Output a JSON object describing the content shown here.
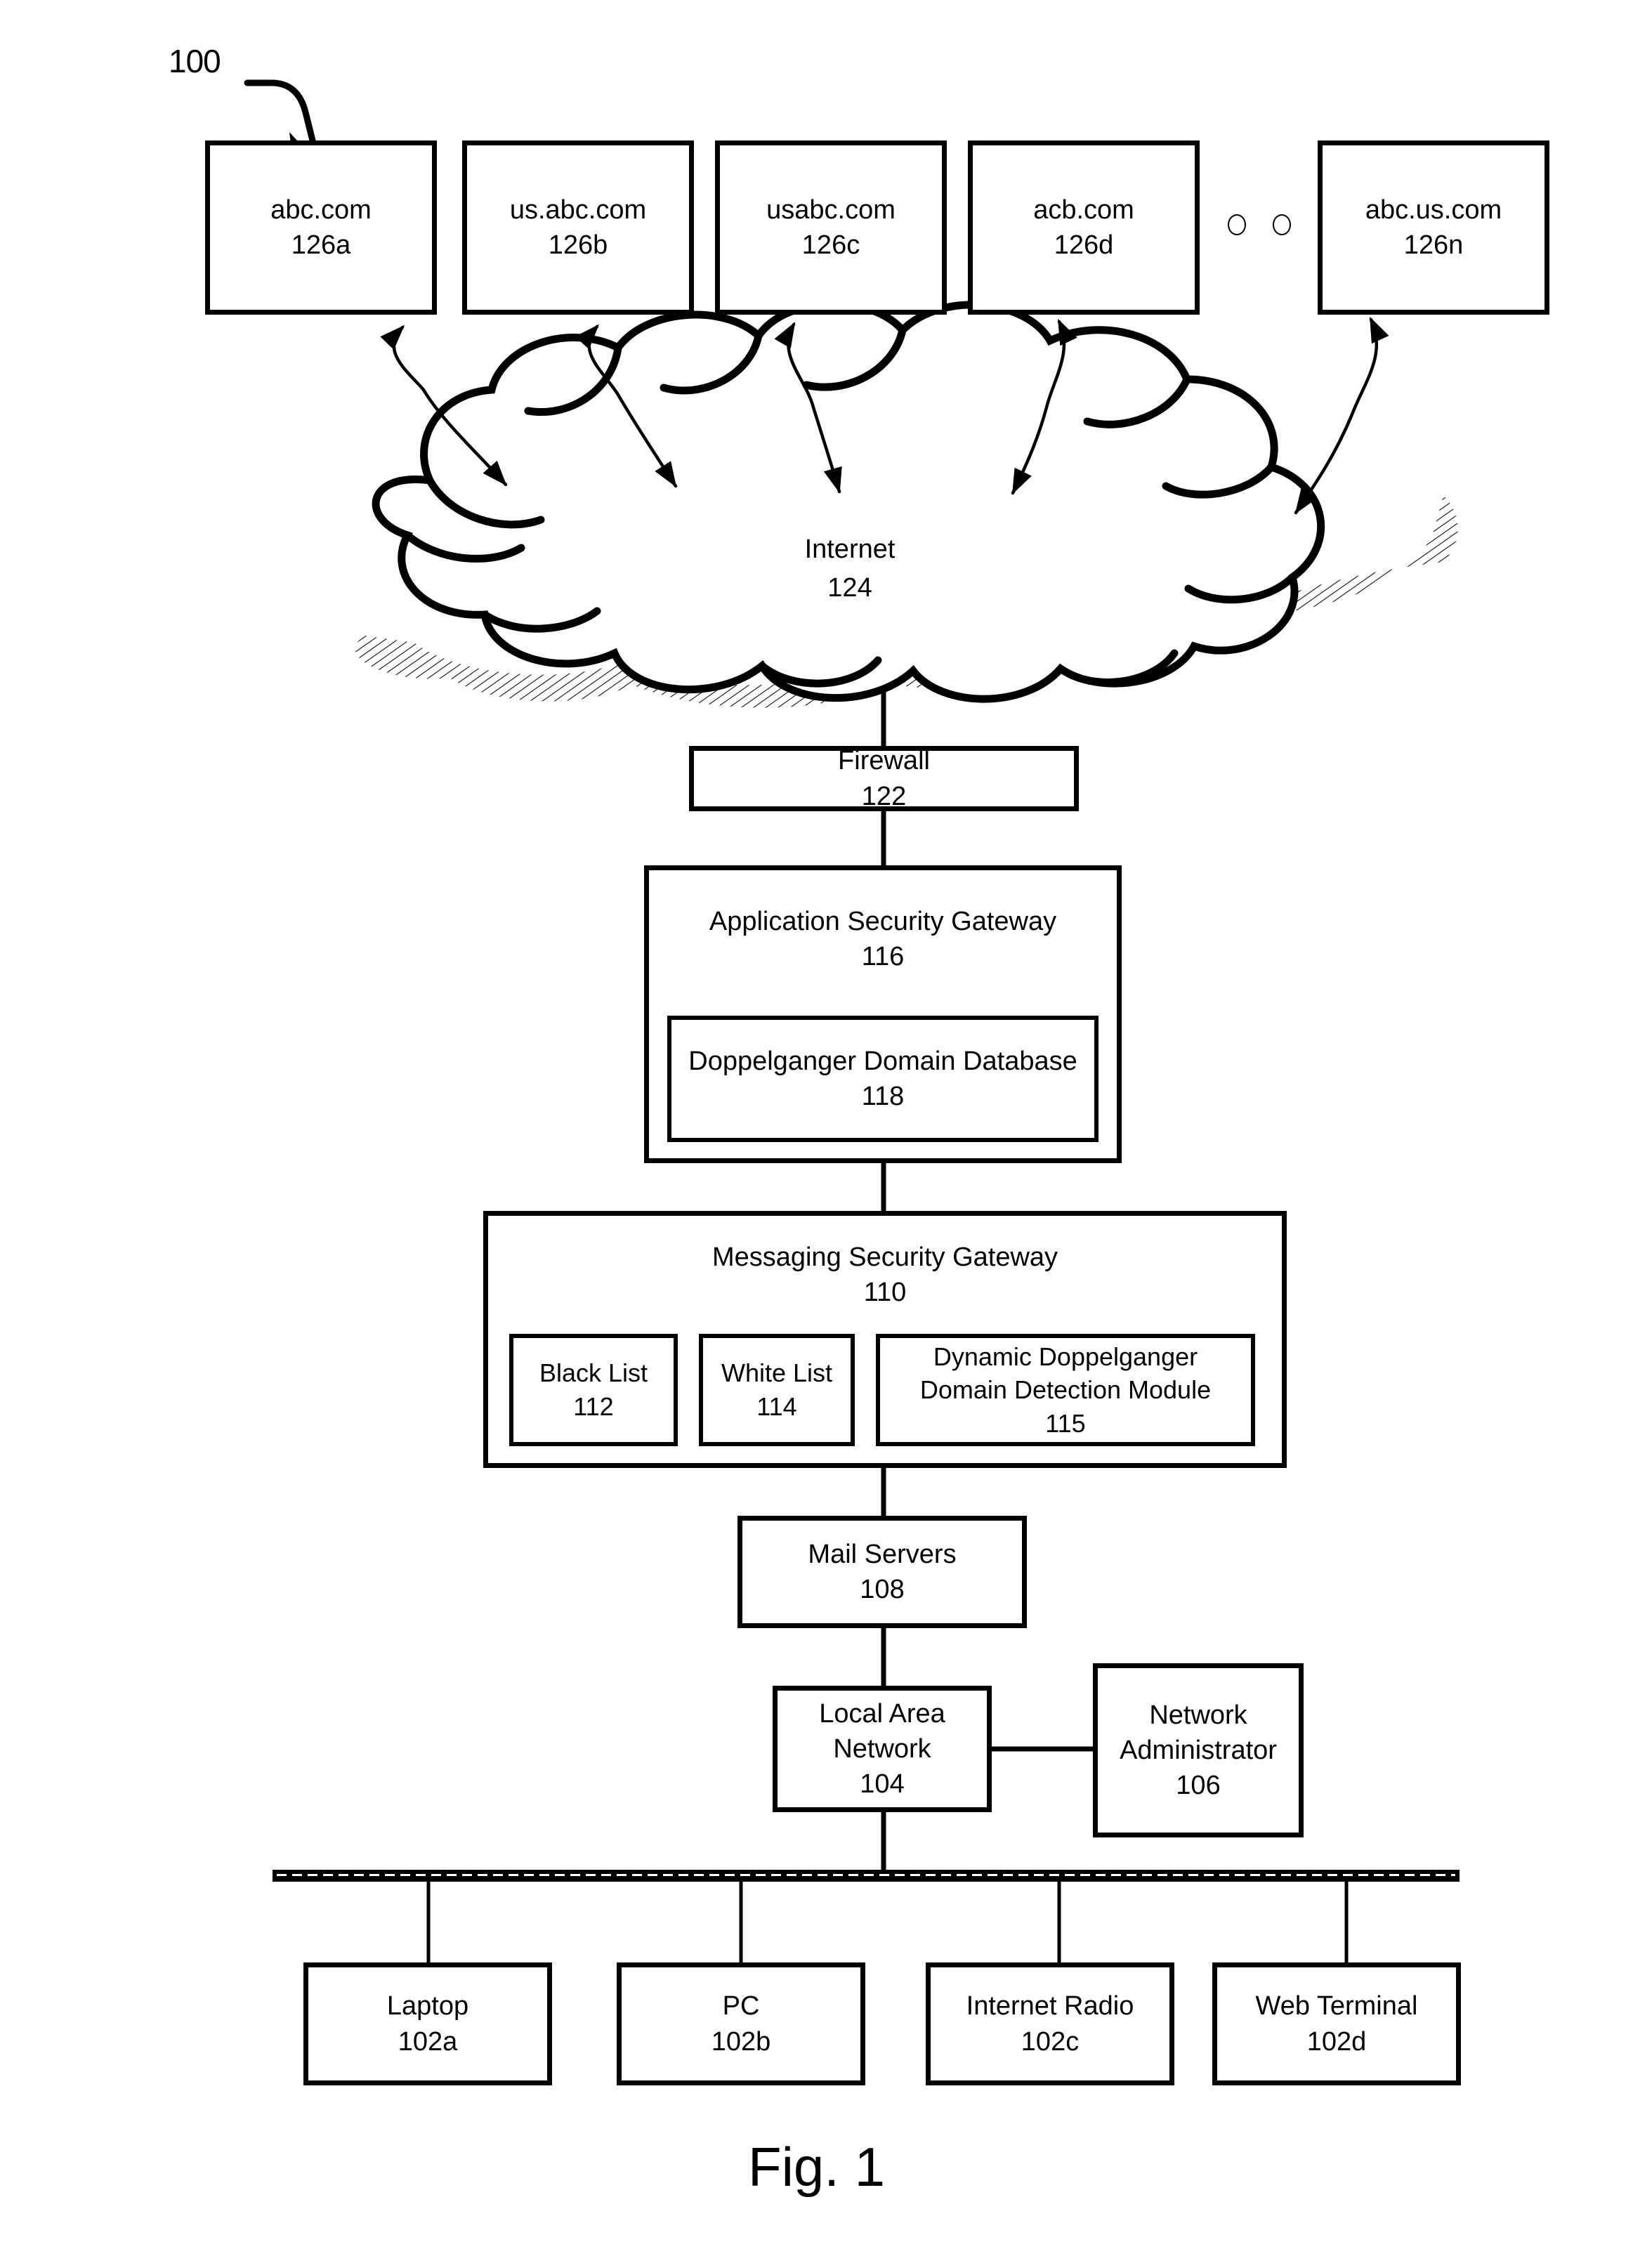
{
  "figure": {
    "caption": "Fig. 1",
    "system_ref": "100"
  },
  "domains": {
    "boxes": [
      {
        "name": "abc.com",
        "ref": "126a"
      },
      {
        "name": "us.abc.com",
        "ref": "126b"
      },
      {
        "name": "usabc.com",
        "ref": "126c"
      },
      {
        "name": "acb.com",
        "ref": "126d"
      },
      {
        "name": "abc.us.com",
        "ref": "126n"
      }
    ],
    "ellipsis": "○ ○ ○"
  },
  "cloud": {
    "name": "Internet",
    "ref": "124"
  },
  "firewall": {
    "name": "Firewall",
    "ref": "122"
  },
  "application_security_gateway": {
    "name": "Application Security Gateway",
    "ref": "116",
    "database": {
      "name": "Doppelganger Domain Database",
      "ref": "118"
    }
  },
  "messaging_security_gateway": {
    "name": "Messaging Security Gateway",
    "ref": "110",
    "modules": [
      {
        "name": "Black List",
        "ref": "112"
      },
      {
        "name": "White List",
        "ref": "114"
      },
      {
        "name_line1": "Dynamic Doppelganger",
        "name_line2": "Domain Detection Module",
        "ref": "115"
      }
    ]
  },
  "mail_servers": {
    "name": "Mail Servers",
    "ref": "108"
  },
  "local_area_network": {
    "name_line1": "Local Area",
    "name_line2": "Network",
    "ref": "104"
  },
  "network_administrator": {
    "name_line1": "Network",
    "name_line2": "Administrator",
    "ref": "106"
  },
  "clients": [
    {
      "name": "Laptop",
      "ref": "102a"
    },
    {
      "name": "PC",
      "ref": "102b"
    },
    {
      "name": "Internet Radio",
      "ref": "102c"
    },
    {
      "name": "Web Terminal",
      "ref": "102d"
    }
  ],
  "colors": {
    "stroke": "#000000",
    "background": "#ffffff"
  }
}
